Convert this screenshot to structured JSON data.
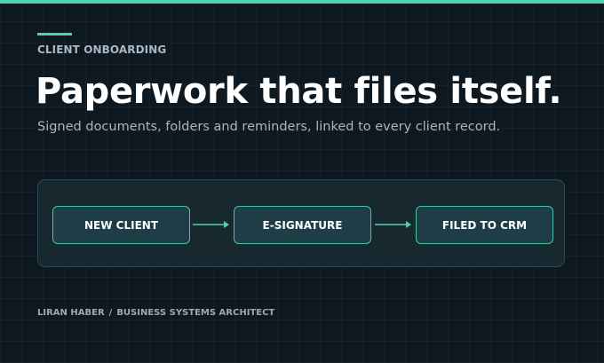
{
  "header": {
    "eyebrow": "CLIENT ONBOARDING",
    "headline": "Paperwork that files itself.",
    "subtitle": "Signed documents, folders and reminders, linked to every client record."
  },
  "flow": {
    "steps": [
      {
        "label": "NEW CLIENT"
      },
      {
        "label": "E-SIGNATURE"
      },
      {
        "label": "FILED TO CRM"
      }
    ]
  },
  "footer": {
    "author": "LIRAN HABER",
    "separator": "/",
    "role": "BUSINESS SYSTEMS ARCHITECT"
  },
  "colors": {
    "background": "#0d1821",
    "accent": "#4fd1b4",
    "panel": "#17292f",
    "step_fill": "#1f3d46"
  },
  "icons": {
    "connector": "arrow-right-icon"
  }
}
